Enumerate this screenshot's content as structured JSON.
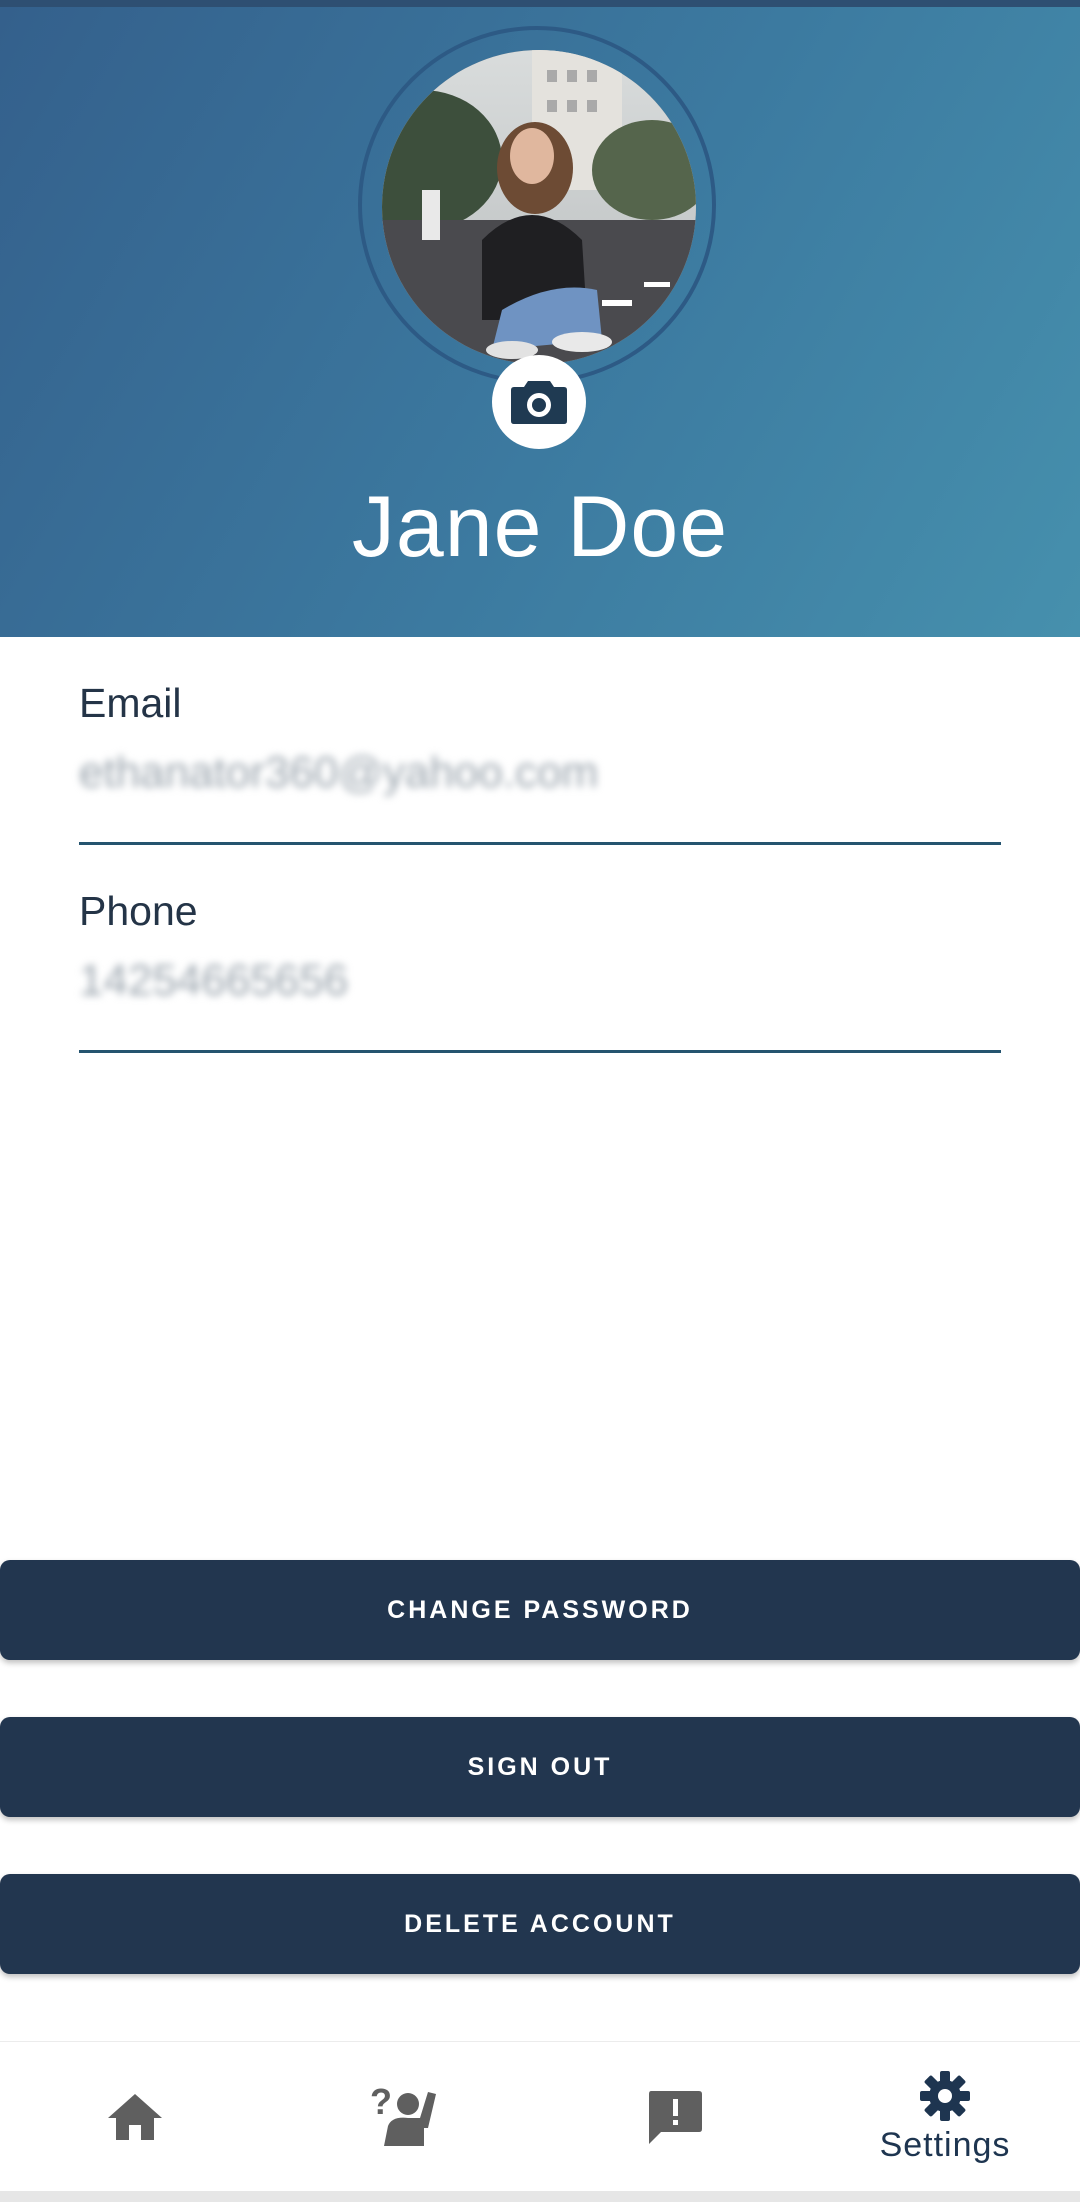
{
  "profile": {
    "name": "Jane Doe",
    "avatar_alt": "Profile photo"
  },
  "fields": [
    {
      "label": "Email",
      "value": "ethanator360@yahoo.com"
    },
    {
      "label": "Phone",
      "value": "14254665656"
    }
  ],
  "buttons": {
    "change_password": "CHANGE PASSWORD",
    "sign_out": "SIGN OUT",
    "delete_account": "DELETE ACCOUNT"
  },
  "nav": {
    "items": [
      {
        "icon": "home-icon",
        "label": ""
      },
      {
        "icon": "help-person-icon",
        "label": ""
      },
      {
        "icon": "feedback-alert-icon",
        "label": ""
      },
      {
        "icon": "gear-icon",
        "label": "Settings",
        "selected": true
      }
    ]
  },
  "colors": {
    "header_start": "#34608c",
    "header_end": "#4690ad",
    "button_bg": "#22364f",
    "nav_active": "#1e3550",
    "nav_inactive": "#5f5f5f"
  }
}
